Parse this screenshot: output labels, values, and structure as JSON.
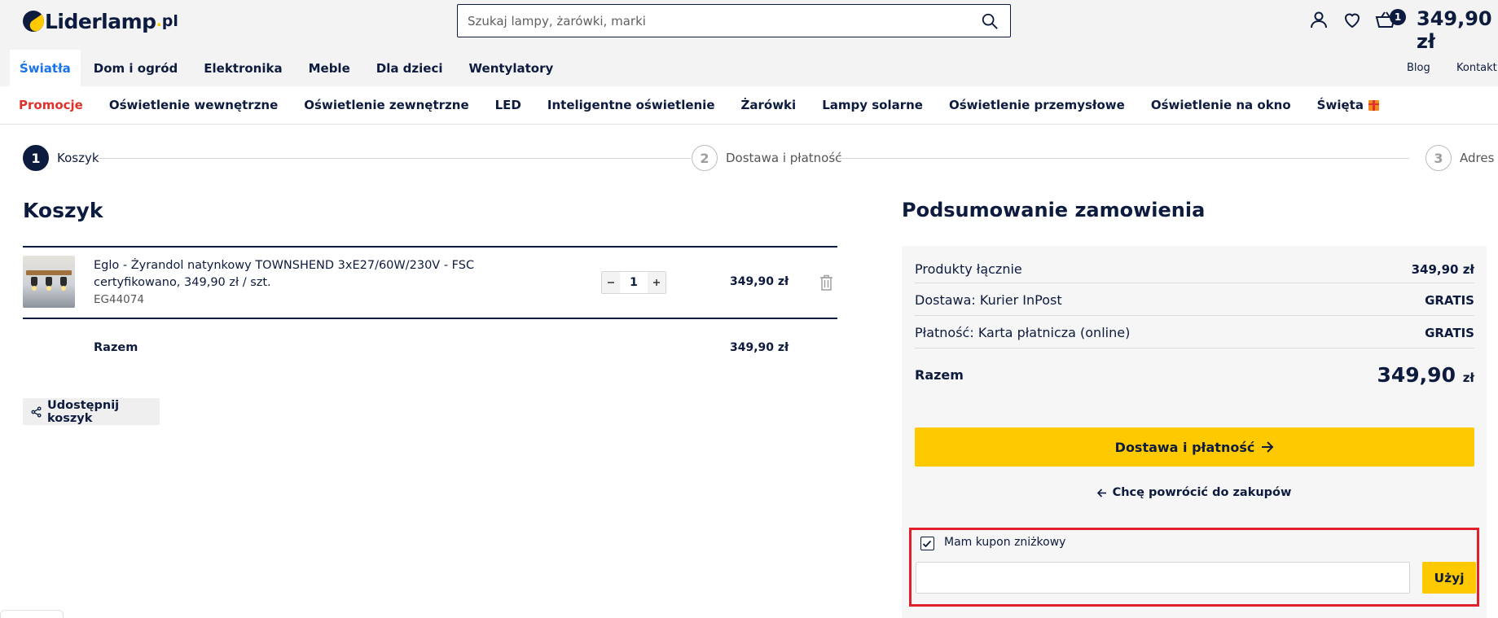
{
  "header": {
    "logo_text": "Liderlamp",
    "logo_tld": "pl",
    "search_placeholder": "Szukaj lampy, żarówki, marki",
    "cart_count": "1",
    "cart_total": "349,90 zł"
  },
  "nav_primary": {
    "items": [
      "Światła",
      "Dom i ogród",
      "Elektronika",
      "Meble",
      "Dla dzieci",
      "Wentylatory"
    ],
    "right": [
      "Blog",
      "Kontakt"
    ]
  },
  "nav_secondary": {
    "items": [
      "Promocje",
      "Oświetlenie wewnętrzne",
      "Oświetlenie zewnętrzne",
      "LED",
      "Inteligentne oświetlenie",
      "Żarówki",
      "Lampy solarne",
      "Oświetlenie przemysłowe",
      "Oświetlenie na okno",
      "Święta"
    ]
  },
  "stepper": {
    "steps": [
      {
        "num": "1",
        "label": "Koszyk"
      },
      {
        "num": "2",
        "label": "Dostawa i płatność"
      },
      {
        "num": "3",
        "label": "Adres"
      }
    ]
  },
  "cart": {
    "title": "Koszyk",
    "item": {
      "name": "Eglo - Żyrandol natynkowy TOWNSHEND 3xE27/60W/230V - FSC certyfikowano, 349,90 zł / szt.",
      "sku": "EG44074",
      "quantity": "1",
      "price": "349,90 zł"
    },
    "total_label": "Razem",
    "total_value": "349,90 zł",
    "share_label": "Udostępnij koszyk"
  },
  "summary": {
    "title": "Podsumowanie zamowienia",
    "rows": [
      {
        "label": "Produkty łącznie",
        "value": "349,90 zł"
      },
      {
        "label": "Dostawa: Kurier InPost",
        "value": "GRATIS"
      },
      {
        "label": "Płatność: Karta płatnicza (online)",
        "value": "GRATIS"
      }
    ],
    "total_label": "Razem",
    "total_value": "349,90",
    "total_currency": "zł",
    "cta_label": "Dostawa i płatność",
    "back_label": "Chcę powrócić do zakupów",
    "coupon_label": "Mam kupon zniżkowy",
    "coupon_button": "Użyj"
  },
  "colors": {
    "navy": "#0d1b3e",
    "accent_yellow": "#ffc900",
    "promo_red": "#e0322d",
    "active_blue": "#1a73e8",
    "highlight_red": "#e0202a"
  }
}
